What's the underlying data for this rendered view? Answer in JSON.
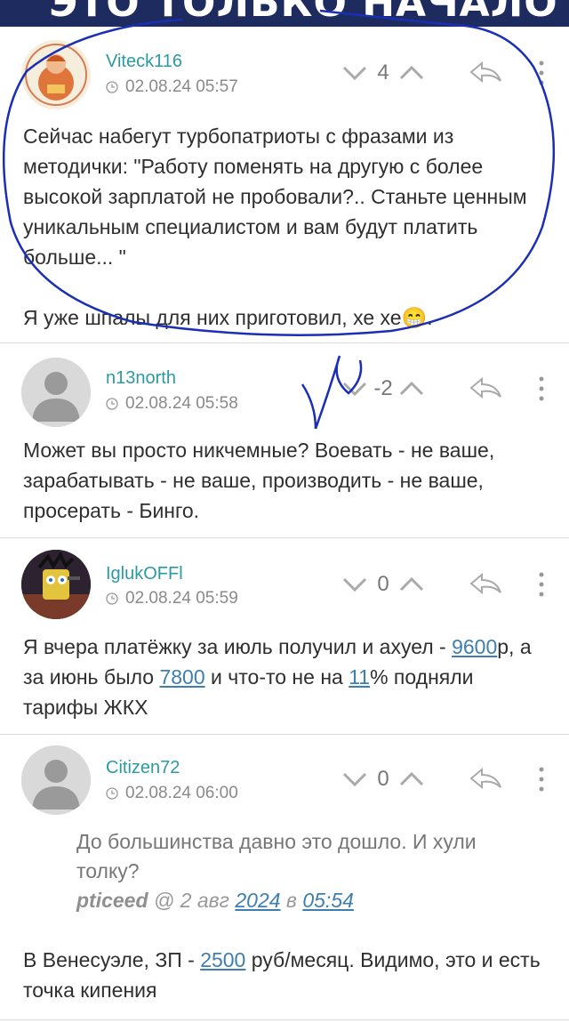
{
  "banner": {
    "text": "ЭТО ТОЛЬКО НАЧАЛО"
  },
  "comments": [
    {
      "author": "Viteck116",
      "timestamp": "02.08.24 05:57",
      "score": "4",
      "avatar": "monk-figure-avatar",
      "paragraphs": [
        "Сейчас набегут турбопатриоты с фразами из методички: \"Работу поменять на другую с более высокой зарплатой не пробовали?.. Станьте ценным уникальным специалистом и вам будут платить больше... \"",
        "Я уже шпалы для них приготовил, хе хе",
        "😁",
        "."
      ]
    },
    {
      "author": "n13north",
      "timestamp": "02.08.24 05:58",
      "score": "-2",
      "avatar": "default-user-avatar",
      "paragraphs": [
        "Может вы просто никчемные? Воевать - не ваше, зарабатывать - не ваше, производить - не ваше, просерать - Бинго."
      ]
    },
    {
      "author": "IglukOFFl",
      "timestamp": "02.08.24 05:59",
      "score": "0",
      "avatar": "sponge-character-avatar",
      "text_parts": [
        "Я вчера платёжку за июль получил и ахуел - ",
        "9600",
        "р, а за июнь было ",
        "7800",
        " и что-то не на ",
        "11",
        "% подняли тарифы ЖКХ"
      ]
    },
    {
      "author": "Citizen72",
      "timestamp": "02.08.24 06:00",
      "score": "0",
      "avatar": "default-user-avatar",
      "quote": {
        "text": "До большинства давно это дошло. И хули толку?",
        "author": "pticeed",
        "at": " @ 2 авг ",
        "year": "2024",
        "in": " в ",
        "time": "05:54"
      },
      "text_parts": [
        "В Венесуэле, ЗП - ",
        "2500",
        " руб/месяц. Видимо, это и есть точка кипения"
      ]
    }
  ],
  "icons": {
    "vote_down": "chevron-down-icon",
    "vote_up": "chevron-up-icon",
    "reply": "reply-arrow-icon",
    "more": "more-vertical-icon",
    "clock": "clock-icon"
  },
  "colors": {
    "author": "#2b9aa3",
    "link": "#3d7fb0",
    "annotation_ink": "#1a2fb5"
  }
}
